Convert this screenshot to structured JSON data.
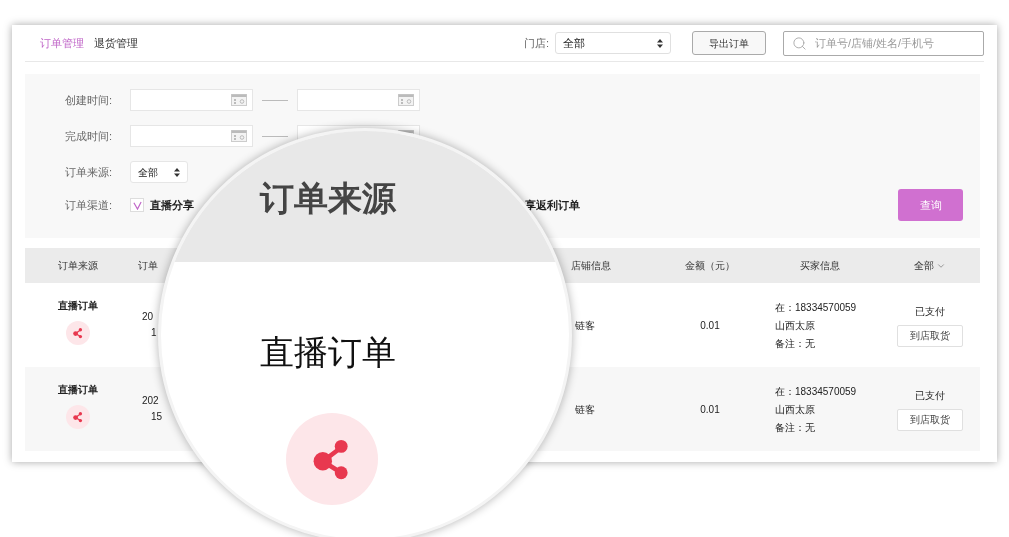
{
  "tabs": [
    {
      "label": "订单管理",
      "selected": true
    },
    {
      "label": "退货管理",
      "selected": false
    }
  ],
  "store_filter": {
    "label": "门店:",
    "value": "全部"
  },
  "export_button": "导出订单",
  "search": {
    "placeholder": "订单号/店铺/姓名/手机号"
  },
  "filters": {
    "created_time": {
      "label": "创建时间:"
    },
    "completed_time": {
      "label": "完成时间:"
    },
    "order_source": {
      "label": "订单来源:",
      "value": "全部"
    },
    "order_channel": {
      "label": "订单渠道:",
      "options": [
        {
          "label": "直播分享",
          "checked": true
        },
        {
          "label": "享返利订单"
        }
      ]
    }
  },
  "query_button": "查询",
  "table": {
    "columns": [
      "订单来源",
      "订单",
      "店铺信息",
      "金额（元）",
      "买家信息"
    ],
    "status_filter": "全部",
    "rows": [
      {
        "source": "直播订单",
        "column_2": [
          "20",
          "1"
        ],
        "store": "链客",
        "amount": "0.01",
        "buyer": [
          "在：18334570059",
          "山西太原",
          "备注：无"
        ],
        "status": "已支付",
        "action": "到店取货"
      },
      {
        "source": "直播订单",
        "column_2": [
          "202",
          "15"
        ],
        "store": "链客",
        "amount": "0.01",
        "buyer": [
          "在：18334570059",
          "山西太原",
          "备注：无"
        ],
        "status": "已支付",
        "action": "到店取货"
      }
    ]
  },
  "magnifier": {
    "heading": "订单来源",
    "source": "直播订单"
  }
}
